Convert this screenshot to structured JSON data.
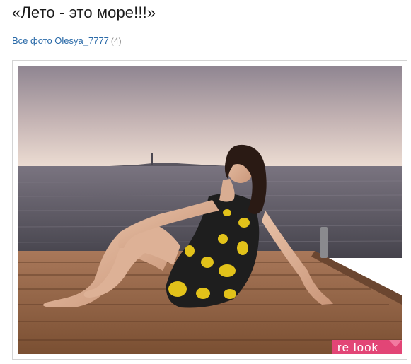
{
  "page": {
    "title": "«Лето - это море!!!»"
  },
  "album": {
    "link_label": "Все фото Olesya_7777",
    "count": "(4)"
  },
  "photo": {
    "watermark_text": "re look",
    "sky_top": "#8a7f8c",
    "sky_horizon": "#e9d8cf",
    "sea": "#56525c",
    "deck": "#8a5e3e",
    "dress": "#1e1e1e",
    "dots": "#e2c21a",
    "watermark_color": "#e8457a"
  }
}
